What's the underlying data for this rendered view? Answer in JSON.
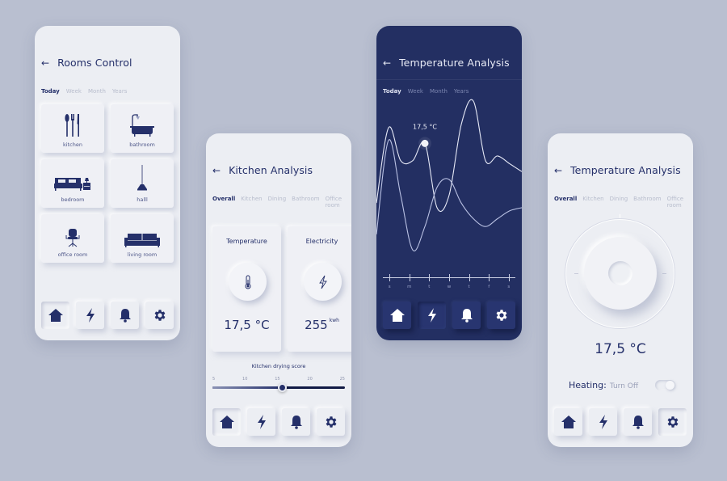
{
  "colors": {
    "background": "#b9bfd0",
    "accent": "#25306a",
    "dark_panel": "#232f62",
    "light_panel": "#eceef3"
  },
  "rooms_control": {
    "title": "Rooms Control",
    "back_icon": "arrow-left-icon",
    "tabs": [
      {
        "label": "Today",
        "active": true
      },
      {
        "label": "Week",
        "active": false
      },
      {
        "label": "Month",
        "active": false
      },
      {
        "label": "Years",
        "active": false
      }
    ],
    "rooms": [
      {
        "label": "kitchen",
        "icon": "cutlery-icon"
      },
      {
        "label": "bathroom",
        "icon": "bathtub-icon"
      },
      {
        "label": "bedroom",
        "icon": "bed-icon"
      },
      {
        "label": "halll",
        "icon": "pendant-lamp-icon"
      },
      {
        "label": "office room",
        "icon": "office-chair-icon"
      },
      {
        "label": "living room",
        "icon": "sofa-icon"
      }
    ],
    "nav": [
      {
        "icon": "home-icon",
        "active": true
      },
      {
        "icon": "lightning-icon",
        "active": false
      },
      {
        "icon": "bell-icon",
        "active": false
      },
      {
        "icon": "gear-icon",
        "active": false
      }
    ]
  },
  "kitchen_analysis": {
    "title": "Kitchen Analysis",
    "tabs": [
      {
        "label": "Overall",
        "active": true
      },
      {
        "label": "Kitchen",
        "active": false
      },
      {
        "label": "Dining",
        "active": false
      },
      {
        "label": "Bathroom",
        "active": false
      },
      {
        "label": "Office room",
        "active": false
      }
    ],
    "temperature": {
      "label": "Temperature",
      "value": "17,5 °C",
      "icon": "thermometer-icon"
    },
    "electricity": {
      "label": "Electricity",
      "value": "255",
      "unit": "kwh",
      "icon": "lightning-icon"
    },
    "drying_score": {
      "label": "Kitchen drying score",
      "ticks": [
        "5",
        "10",
        "15",
        "20",
        "25"
      ],
      "min": 5,
      "max": 25,
      "value": 15.5
    },
    "nav": [
      {
        "icon": "home-icon",
        "active": true
      },
      {
        "icon": "lightning-icon",
        "active": false
      },
      {
        "icon": "bell-icon",
        "active": false
      },
      {
        "icon": "gear-icon",
        "active": false
      }
    ]
  },
  "temperature_chart": {
    "title": "Temperature Analysis",
    "tabs": [
      {
        "label": "Today",
        "active": true
      },
      {
        "label": "Week",
        "active": false
      },
      {
        "label": "Month",
        "active": false
      },
      {
        "label": "Years",
        "active": false
      }
    ],
    "highlight_label": "17,5 °C",
    "nav": [
      {
        "icon": "home-icon",
        "active": false
      },
      {
        "icon": "lightning-icon",
        "active": true
      },
      {
        "icon": "bell-icon",
        "active": false
      },
      {
        "icon": "gear-icon",
        "active": false
      }
    ]
  },
  "chart_data": {
    "type": "line",
    "title": "Temperature Analysis",
    "xlabel": "",
    "ylabel": "",
    "categories": [
      "s",
      "m",
      "t",
      "w",
      "t",
      "f",
      "s"
    ],
    "x": [
      0,
      0.5,
      1,
      1.5,
      2,
      2.5,
      3,
      3.5,
      4,
      4.5,
      5,
      5.5,
      6
    ],
    "ylim": [
      0,
      10
    ],
    "grid": false,
    "series": [
      {
        "name": "series-a",
        "values": [
          3.5,
          8.3,
          6.2,
          6.2,
          7.3,
          3.2,
          4.0,
          8.5,
          10.0,
          6.2,
          6.5,
          6.0,
          5.5
        ]
      },
      {
        "name": "series-b",
        "values": [
          1.5,
          7.5,
          4.0,
          0.5,
          2.0,
          4.5,
          5.0,
          3.5,
          2.5,
          2.0,
          2.5,
          3.0,
          3.2
        ]
      }
    ],
    "highlight": {
      "series": "series-a",
      "x": 2,
      "label": "17,5 °C"
    }
  },
  "temperature_dial": {
    "title": "Temperature Analysis",
    "tabs": [
      {
        "label": "Overall",
        "active": true
      },
      {
        "label": "Kitchen",
        "active": false
      },
      {
        "label": "Dining",
        "active": false
      },
      {
        "label": "Bathroom",
        "active": false
      },
      {
        "label": "Office room",
        "active": false
      }
    ],
    "value": "17,5 °C",
    "heating_label": "Heating:",
    "heating_state": "Turn Off",
    "toggle_on": false,
    "nav": [
      {
        "icon": "home-icon",
        "active": false
      },
      {
        "icon": "lightning-icon",
        "active": false
      },
      {
        "icon": "bell-icon",
        "active": false
      },
      {
        "icon": "gear-icon",
        "active": true
      }
    ]
  }
}
